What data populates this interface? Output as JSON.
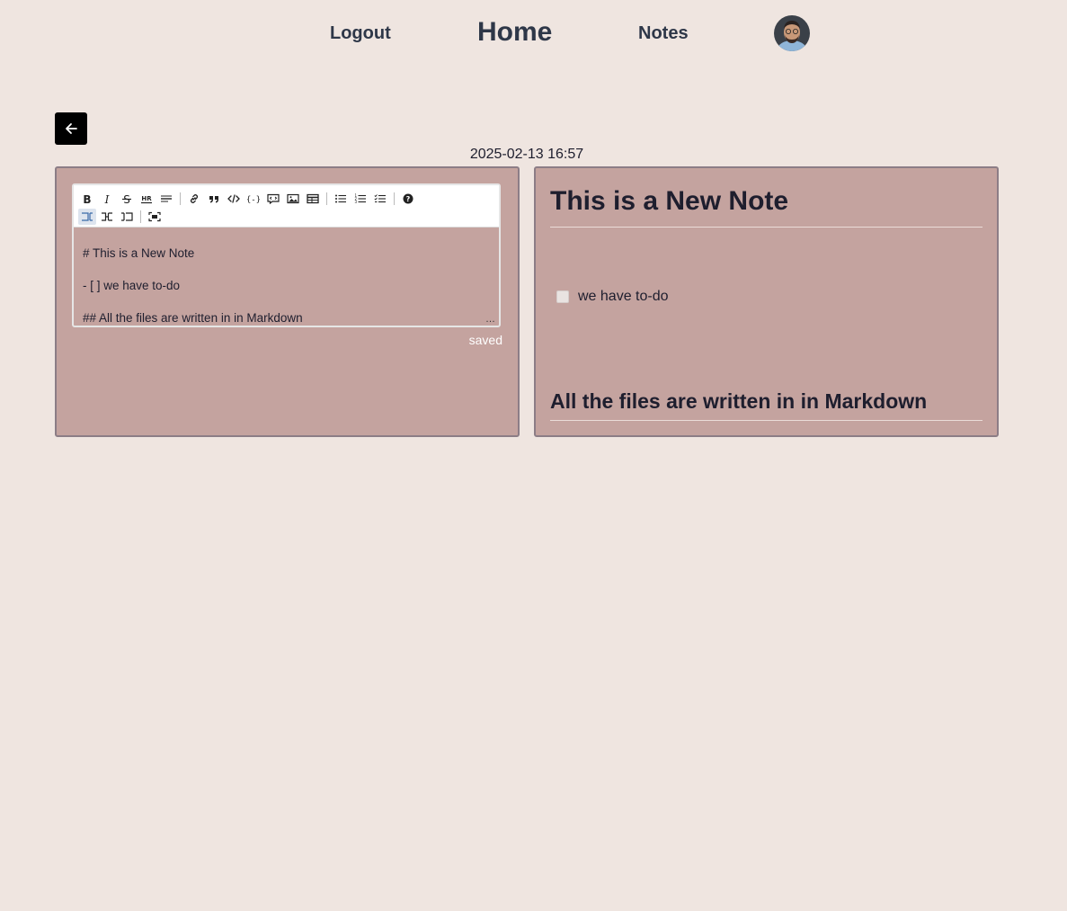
{
  "nav": {
    "logout_label": "Logout",
    "home_label": "Home",
    "notes_label": "Notes"
  },
  "note": {
    "timestamp": "2025-02-13 16:57",
    "save_status": "saved"
  },
  "editor": {
    "toolbar_row1": [
      "bold-icon",
      "italic-icon",
      "strikethrough-icon",
      "heading-icon",
      "horizontal-rule-icon",
      "link-icon",
      "quote-icon",
      "code-icon",
      "code-block-icon",
      "comment-icon",
      "image-icon",
      "table-icon",
      "unordered-list-icon",
      "ordered-list-icon",
      "task-list-icon",
      "help-icon"
    ],
    "toolbar_row2": [
      "edit-mode-icon",
      "live-mode-icon",
      "preview-mode-icon",
      "fullscreen-icon"
    ],
    "lines": [
      "# This is a New Note",
      "- [ ] we have to-do",
      "## All the files are written in in Markdown"
    ]
  },
  "preview": {
    "heading1": "This is a New Note",
    "task_item": "we have to-do",
    "task_checked": false,
    "heading2": "All the files are written in in Markdown"
  },
  "colors": {
    "page_background": "#efe5e0",
    "panel_background": "#c4a39f",
    "panel_border": "#8c7d86",
    "nav_text": "#2e3748"
  }
}
